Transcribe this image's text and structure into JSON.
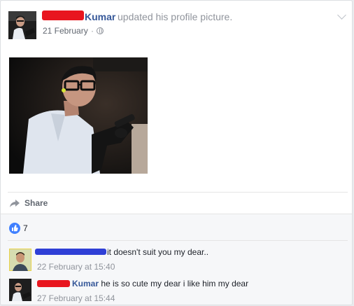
{
  "post": {
    "author_name": "Kumar",
    "action": "updated his profile picture.",
    "date": "21 February",
    "separator": "·",
    "privacy_icon": "globe-icon",
    "menu_icon": "chevron-down-icon"
  },
  "actions": {
    "share_label": "Share",
    "share_icon": "share-arrow-icon"
  },
  "reactions": {
    "like_icon": "thumbs-up-icon",
    "count": "7"
  },
  "comments": [
    {
      "name": "",
      "text": "it doesn't suit you my dear..",
      "time": "22 February at 15:40"
    },
    {
      "name": "Kumar",
      "text": "he is so cute my dear i like him my dear",
      "time": "27 February at 15:44"
    }
  ],
  "colors": {
    "link": "#365899",
    "like_blue": "#4080ff",
    "redaction_red": "#e8161f",
    "redaction_blue": "#2f3fd6"
  }
}
